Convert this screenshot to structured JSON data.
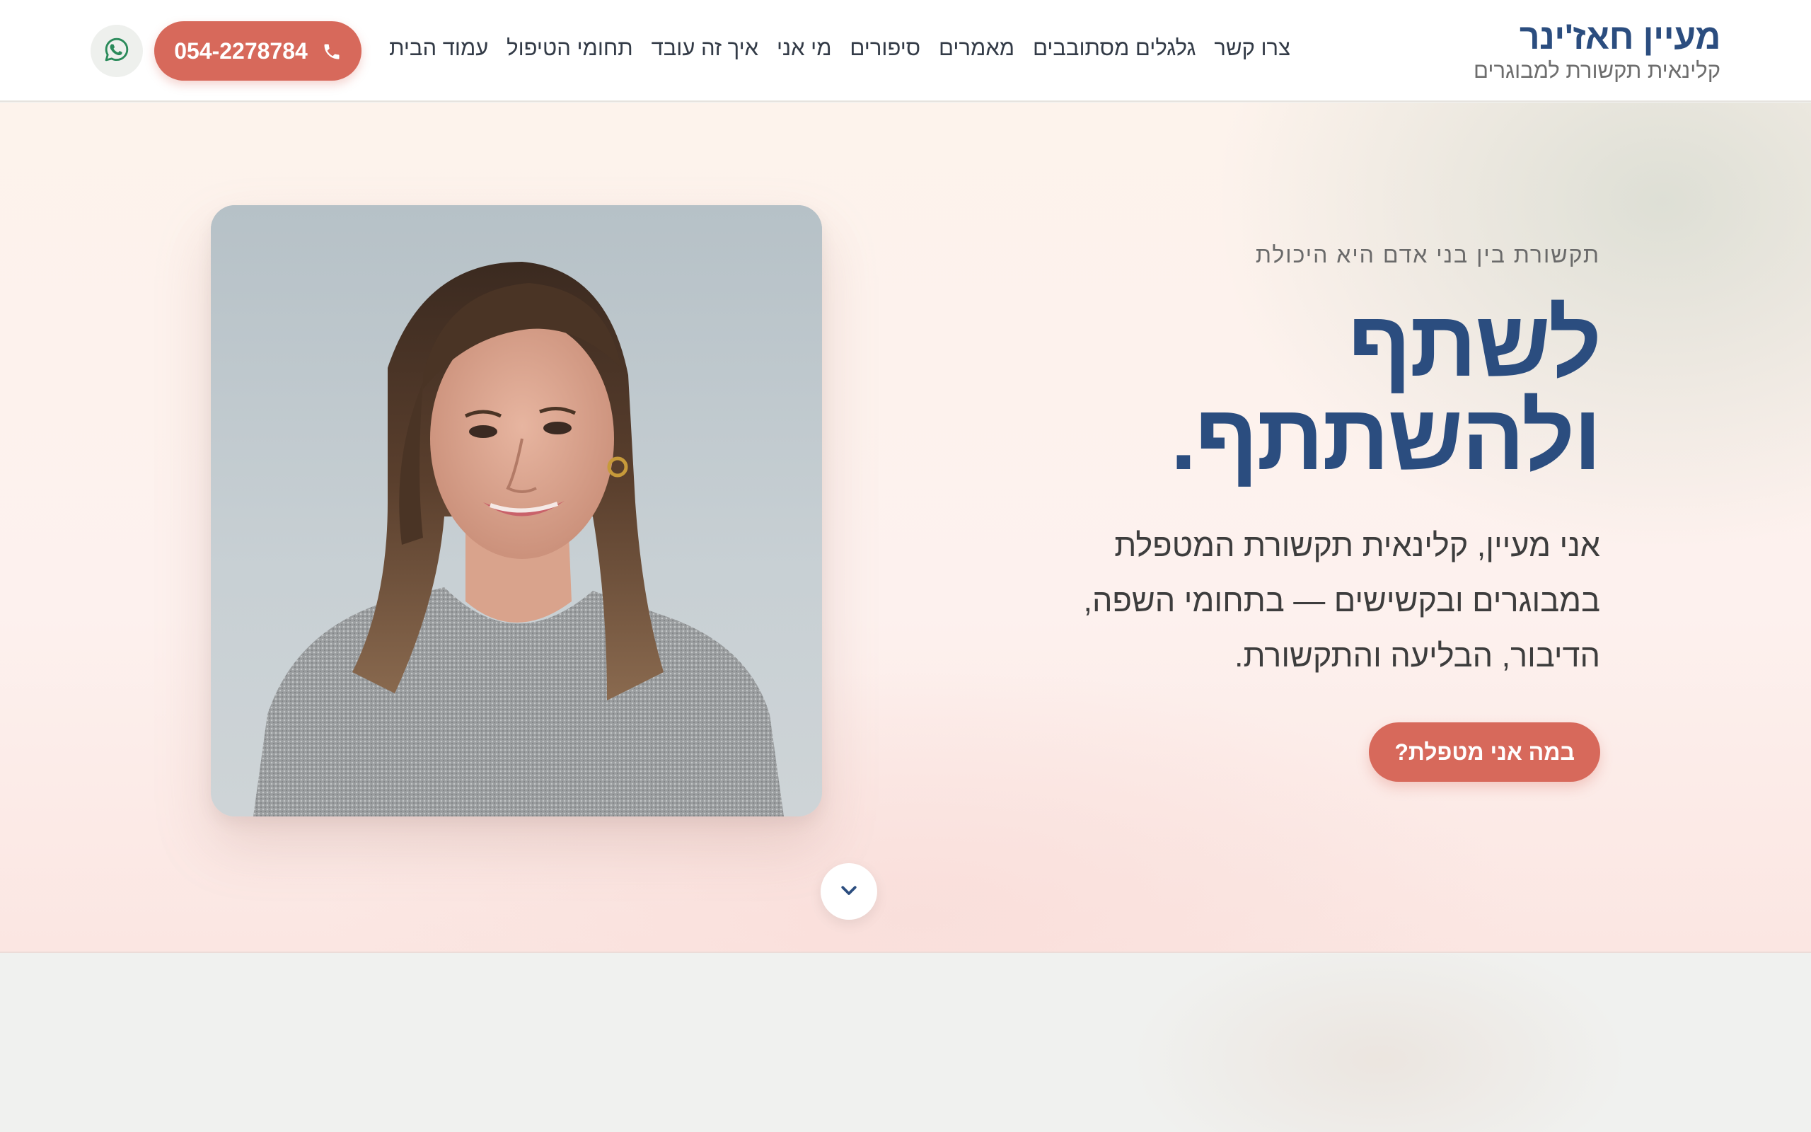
{
  "brand": {
    "name": "מעיין חאז'ינר",
    "subtitle": "קלינאית תקשורת למבוגרים"
  },
  "nav": {
    "items": [
      {
        "label": "עמוד הבית"
      },
      {
        "label": "תחומי הטיפול"
      },
      {
        "label": "איך זה עובד"
      },
      {
        "label": "מי אני"
      },
      {
        "label": "סיפורים"
      },
      {
        "label": "מאמרים"
      },
      {
        "label": "גלגלים מסתובבים"
      },
      {
        "label": "צרו קשר"
      }
    ]
  },
  "header_actions": {
    "phone": "054-2278784",
    "phone_icon": "phone-icon",
    "whatsapp_icon": "whatsapp-icon"
  },
  "hero": {
    "eyebrow": "תקשורת בין בני אדם היא היכולת",
    "headline_line1": "לשתף",
    "headline_line2": "ולהשתתף.",
    "lead": "אני מעיין, קלינאית תקשורת המטפלת במבוגרים ובקשישים — בתחומי השפה, הדיבור, הבליעה והתקשורת.",
    "cta_label": "במה אני מטפלת?",
    "scroll_icon": "chevron-down-icon"
  },
  "colors": {
    "brand_blue": "#2b4d7f",
    "accent_coral": "#d7695b",
    "hero_bg": "#fdf3ec",
    "whatsapp_green": "#2a8a5a"
  }
}
